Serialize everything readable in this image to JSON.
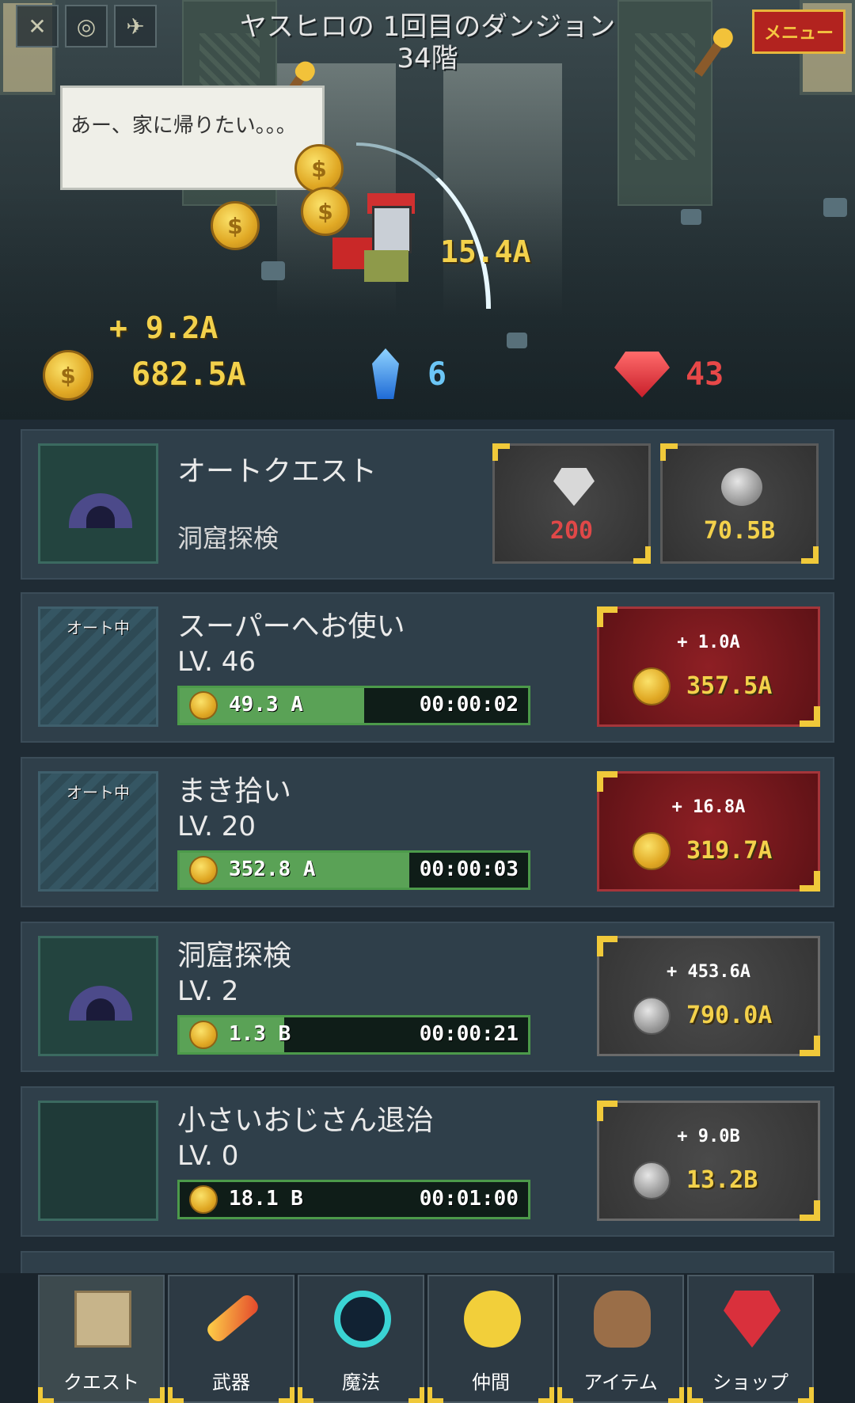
{
  "header": {
    "title_line1": "ヤスヒロの 1回目のダンジョン",
    "title_line2": "34階",
    "menu_label": "メニュー",
    "hud_icons": [
      "crossed-swords-icon",
      "coin-stack-icon",
      "winged-boot-icon"
    ]
  },
  "scene": {
    "speech": "あー、家に帰りたい。。。",
    "damage": "15.4A",
    "gain": "+ 9.2A"
  },
  "currency": {
    "gold": "682.5A",
    "crystal": "6",
    "ruby": "43"
  },
  "quests": {
    "auto": {
      "title": "オートクエスト",
      "subtitle": "洞窟探検",
      "diamond_cost": "200",
      "silver_cost": "70.5B"
    },
    "items": [
      {
        "auto_tag": "オート中",
        "title": "スーパーへお使い",
        "level": "LV. 46",
        "progress_value": "49.3 A",
        "progress": 0.53,
        "timer": "00:00:02",
        "upgrade_plus": "+ 1.0A",
        "upgrade_cost": "357.5A"
      },
      {
        "auto_tag": "オート中",
        "title": "まき拾い",
        "level": "LV. 20",
        "progress_value": "352.8 A",
        "progress": 0.66,
        "timer": "00:00:03",
        "upgrade_plus": "+ 16.8A",
        "upgrade_cost": "319.7A"
      },
      {
        "title": "洞窟探検",
        "level": "LV. 2",
        "progress_value": "1.3 B",
        "progress": 0.3,
        "timer": "00:00:21",
        "upgrade_plus": "+ 453.6A",
        "upgrade_cost": "790.0A"
      },
      {
        "title": "小さいおじさん退治",
        "level": "LV. 0",
        "progress_value": "18.1 B",
        "progress": 0.0,
        "timer": "00:01:00",
        "upgrade_plus": "+ 9.0B",
        "upgrade_cost": "13.2B"
      }
    ]
  },
  "tabs": [
    {
      "label": "クエスト",
      "icon": "scroll-icon"
    },
    {
      "label": "武器",
      "icon": "flame-sword-icon"
    },
    {
      "label": "魔法",
      "icon": "magic-circle-icon"
    },
    {
      "label": "仲間",
      "icon": "chick-icon"
    },
    {
      "label": "アイテム",
      "icon": "bag-icon"
    },
    {
      "label": "ショップ",
      "icon": "ruby-icon"
    }
  ],
  "colors": {
    "gold_text": "#f3d14b",
    "crystal_text": "#6cc6f6",
    "ruby_text": "#e84848",
    "accent_corner": "#f0c93a",
    "red_button": "#8e1f24"
  }
}
